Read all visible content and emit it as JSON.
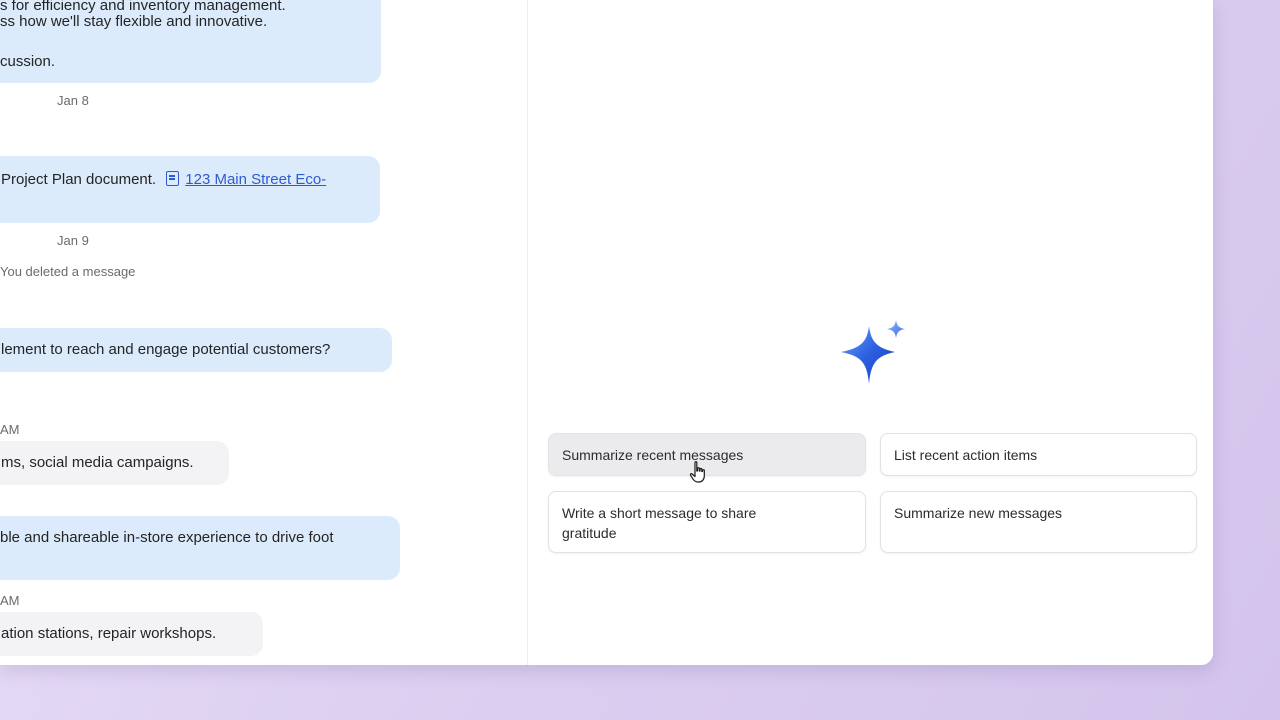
{
  "chat": {
    "msg1_line1": "s for efficiency and inventory management.",
    "msg1_line2": "ss how we'll stay flexible and innovative.",
    "msg1_line3": "cussion.",
    "date1": "Jan 8",
    "msg2_text": "Project Plan document.",
    "msg2_link": "123 Main Street Eco-",
    "date2": "Jan 9",
    "deleted_notice": "You deleted a message",
    "msg3": "lement to reach and engage potential customers?",
    "meta1": "AM",
    "msg4": "ms, social media campaigns.",
    "msg5": "ble and shareable in-store experience to drive foot",
    "meta2": "AM",
    "msg6": "ation stations, repair workshops."
  },
  "ai": {
    "sparkle_icon": "sparkle-icon",
    "prompts": [
      {
        "label": "Summarize recent messages"
      },
      {
        "label": "List recent action items"
      },
      {
        "label": "Write a short message to share gratitude"
      },
      {
        "label": "Summarize new messages"
      }
    ]
  },
  "colors": {
    "sent_bubble": "#dcebfc",
    "received_bubble": "#f3f3f5",
    "link": "#2e5bd1",
    "sparkle": "#2b5fe0"
  }
}
